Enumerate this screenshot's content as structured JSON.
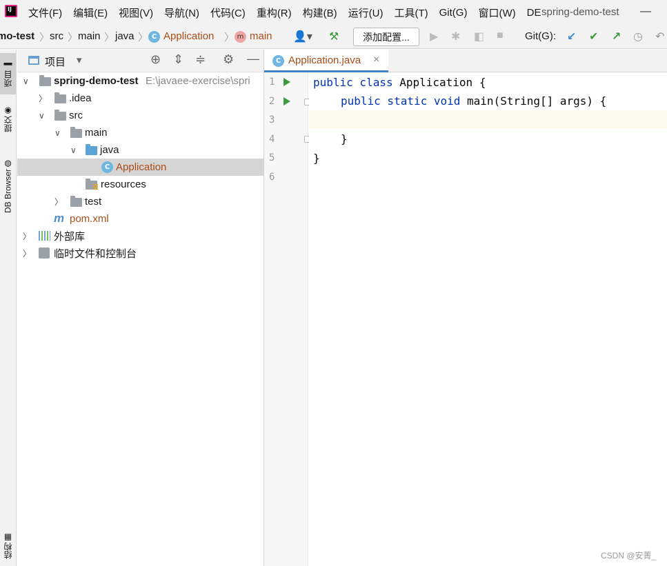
{
  "menubar": {
    "items": [
      "文件(F)",
      "编辑(E)",
      "视图(V)",
      "导航(N)",
      "代码(C)",
      "重构(R)",
      "构建(B)",
      "运行(U)",
      "工具(T)",
      "Git(G)",
      "窗口(W)",
      "DE"
    ],
    "window_title": "spring-demo-test",
    "minimize": "—"
  },
  "navbar": {
    "crumbs": [
      "mo-test",
      "src",
      "main",
      "java",
      "Application",
      "main"
    ],
    "add_config": "添加配置...",
    "git_label": "Git(G):",
    "colors": {
      "accent": "#4083c9",
      "run": "#3c9a3c",
      "highlight": "#a94d17"
    }
  },
  "left_strip": {
    "tabs": [
      "项目",
      "提交",
      "DB Browser",
      "结构"
    ]
  },
  "project": {
    "header": "项目",
    "tree": [
      {
        "label": "spring-demo-test",
        "hint": "E:\\javaee-exercise\\spri",
        "icon": "module-folder-icon"
      },
      {
        "label": ".idea",
        "hint": "",
        "icon": "folder-icon"
      },
      {
        "label": "src",
        "hint": "",
        "icon": "folder-icon"
      },
      {
        "label": "main",
        "hint": "",
        "icon": "folder-icon"
      },
      {
        "label": "java",
        "hint": "",
        "icon": "source-folder-icon"
      },
      {
        "label": "Application",
        "hint": "",
        "icon": "class-icon"
      },
      {
        "label": "resources",
        "hint": "",
        "icon": "resources-folder-icon"
      },
      {
        "label": "test",
        "hint": "",
        "icon": "folder-icon"
      },
      {
        "label": "pom.xml",
        "hint": "",
        "icon": "maven-icon"
      },
      {
        "label": "外部库",
        "hint": "",
        "icon": "library-icon"
      },
      {
        "label": "临时文件和控制台",
        "hint": "",
        "icon": "scratch-icon"
      }
    ]
  },
  "editor": {
    "tab": {
      "label": "Application.java",
      "close": "×"
    },
    "line_numbers": [
      "1",
      "2",
      "3",
      "4",
      "5",
      "6"
    ],
    "code": {
      "l1_kw": "public class",
      "l1_rest": " Application {",
      "l2_kw": "public static void",
      "l2_rest": " main(String[] args) {",
      "l4": "}",
      "l5": "}"
    }
  },
  "watermark": "CSDN @安菁_"
}
